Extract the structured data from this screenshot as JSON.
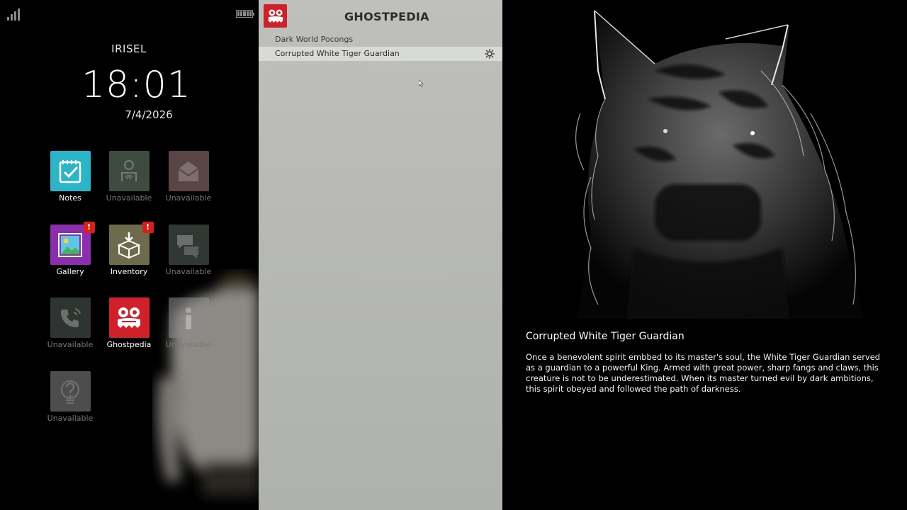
{
  "status_bar": {
    "signal_icon": "signal-bars-icon",
    "battery_icon": "battery-icon"
  },
  "home": {
    "owner": "IRISEL",
    "time": "18:01",
    "date": "7/4/2026",
    "apps": [
      {
        "label": "Notes",
        "icon": "notes-check-icon",
        "available": true,
        "color": "#2bb5c8"
      },
      {
        "label": "Unavailable",
        "icon": "person-wifi-icon",
        "available": false,
        "color": "#6f8a73"
      },
      {
        "label": "Unavailable",
        "icon": "mail-icon",
        "available": false,
        "color": "#9a7a7a"
      },
      {
        "label": "Gallery",
        "icon": "gallery-image-icon",
        "available": true,
        "color": "#8c2fae",
        "badge": "!"
      },
      {
        "label": "Inventory",
        "icon": "box-download-icon",
        "available": true,
        "color": "#6e6b4c",
        "badge": "!"
      },
      {
        "label": "Unavailable",
        "icon": "chat-bubbles-icon",
        "available": false,
        "color": "#5a6660"
      },
      {
        "label": "Unavailable",
        "icon": "phone-call-icon",
        "available": false,
        "color": "#556058"
      },
      {
        "label": "Ghostpedia",
        "icon": "ghost-mask-icon",
        "available": true,
        "color": "#d0202a"
      },
      {
        "label": "Unavailable",
        "icon": "info-icon",
        "available": false,
        "color": "#8d8d8d"
      },
      {
        "label": "Unavailable",
        "icon": "help-icon",
        "available": false,
        "color": "#8d8d8d"
      }
    ]
  },
  "ghostpedia": {
    "title": "GHOSTPEDIA",
    "logo_icon": "ghost-mask-icon",
    "entries": [
      {
        "label": "Dark World Pocongs",
        "selected": false
      },
      {
        "label": "Corrupted White Tiger Guardian",
        "selected": true,
        "icon": "sun-icon"
      }
    ]
  },
  "detail": {
    "name": "Corrupted White Tiger Guardian",
    "description": "Once a benevolent spirit embbed to its master's soul, the White Tiger Guardian served as a guardian to a powerful King. Armed with great power, sharp fangs and claws, this creature is not to be underestimated. When its master turned evil by dark ambitions, this spirit obeyed and followed the path of darkness."
  },
  "colors": {
    "ghostpedia_red": "#d0202a",
    "list_bg": "#b8bab6",
    "selected_row": "#d8dad6"
  }
}
